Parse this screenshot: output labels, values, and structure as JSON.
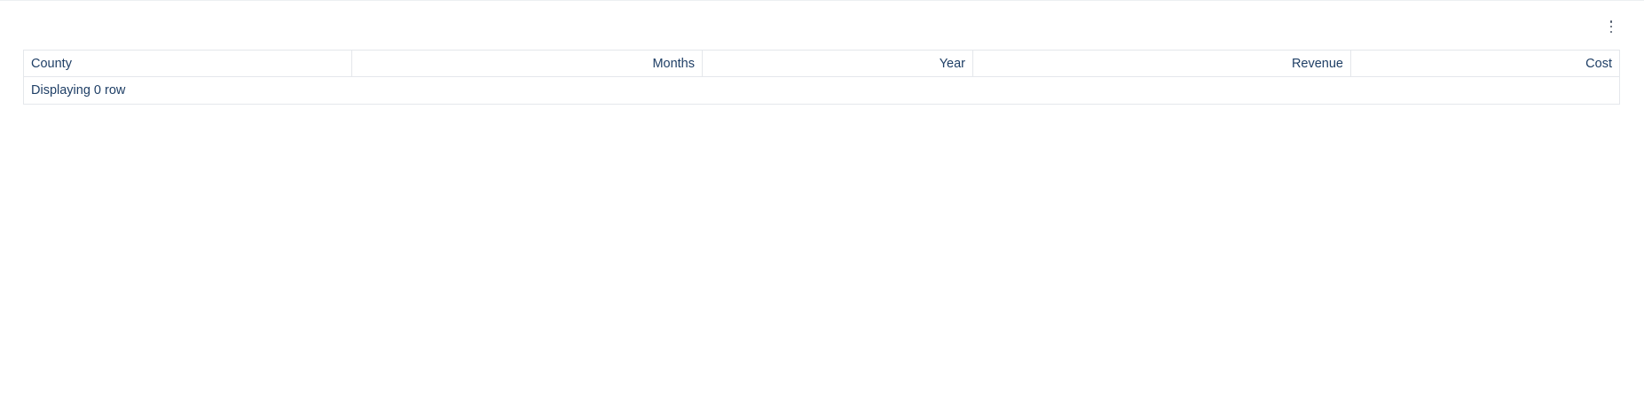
{
  "toolbar": {
    "menu_icon": "kebab-vertical-icon"
  },
  "table": {
    "columns": [
      {
        "key": "county",
        "label": "County",
        "align": "left"
      },
      {
        "key": "months",
        "label": "Months",
        "align": "right"
      },
      {
        "key": "year",
        "label": "Year",
        "align": "right"
      },
      {
        "key": "revenue",
        "label": "Revenue",
        "align": "right"
      },
      {
        "key": "cost",
        "label": "Cost",
        "align": "right"
      }
    ],
    "rows": [],
    "footer_text": "Displaying 0 row"
  },
  "colors": {
    "text": "#1f3f66",
    "border": "#e4e7eb",
    "icon": "#4a5566"
  }
}
